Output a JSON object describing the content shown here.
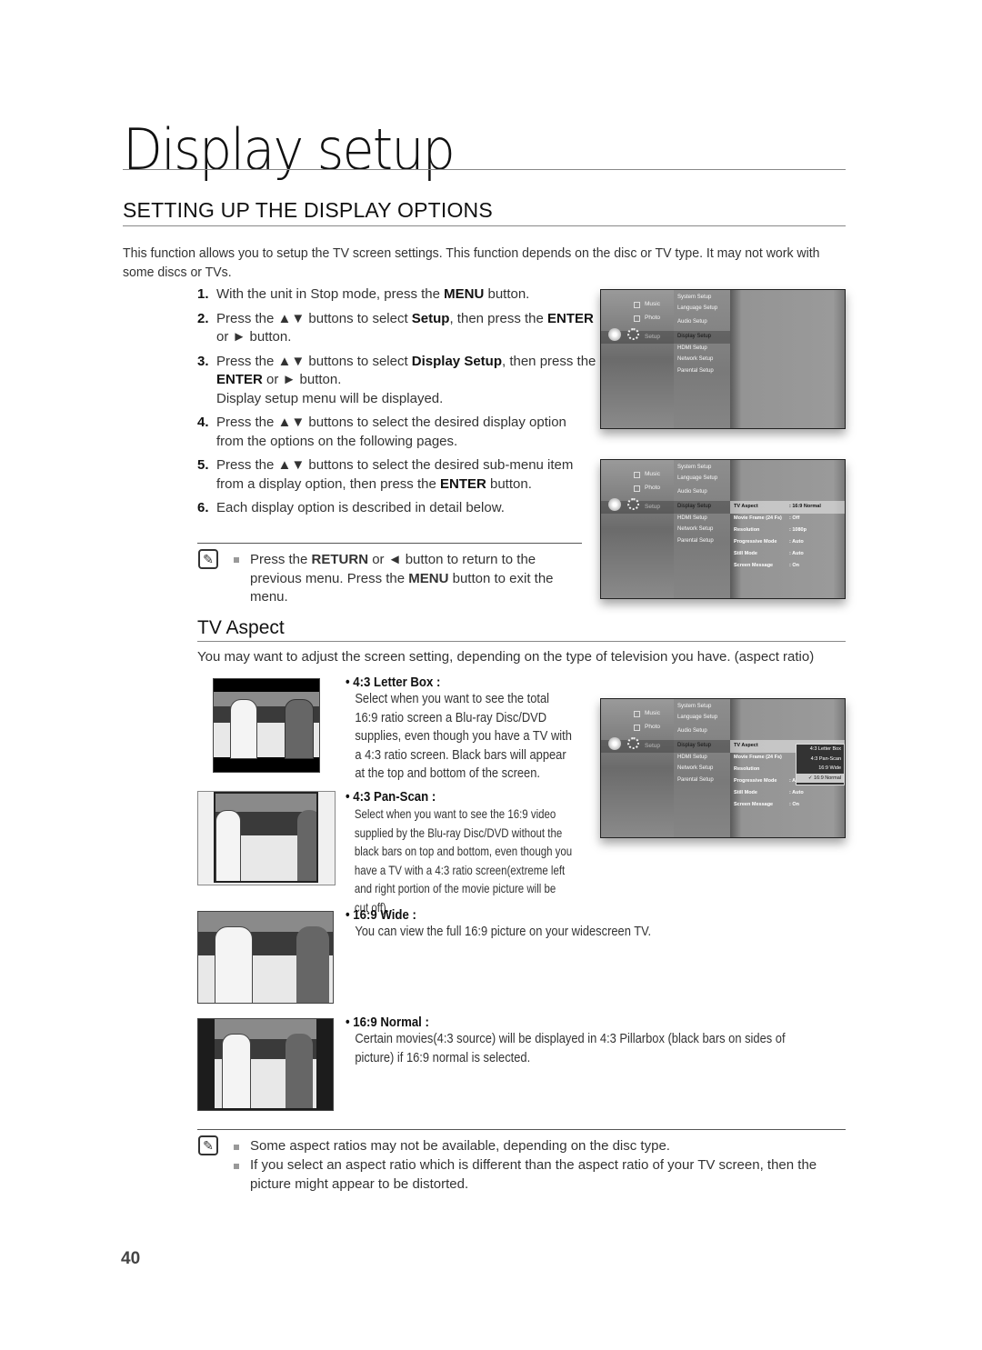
{
  "page": {
    "title": "Display setup",
    "number": "40"
  },
  "section": {
    "title": "SETTING UP THE DISPLAY OPTIONS",
    "intro": "This function allows you to setup the TV screen settings. This function depends on the disc or TV type. It may not work with some discs or TVs."
  },
  "steps": [
    {
      "num": "1.",
      "parts": [
        {
          "t": "With the unit in Stop mode, press the "
        },
        {
          "t": "MENU",
          "b": true
        },
        {
          "t": " button."
        }
      ]
    },
    {
      "num": "2.",
      "parts": [
        {
          "t": "Press the ▲▼ buttons to select "
        },
        {
          "t": "Setup",
          "b": true
        },
        {
          "t": ", then press the "
        },
        {
          "t": "ENTER",
          "b": true
        },
        {
          "t": " or ► button."
        }
      ]
    },
    {
      "num": "3.",
      "parts": [
        {
          "t": "Press the ▲▼ buttons to select "
        },
        {
          "t": "Display Setup",
          "b": true
        },
        {
          "t": ", then press the "
        },
        {
          "t": "ENTER",
          "b": true
        },
        {
          "t": " or ► button."
        },
        {
          "t": "Display setup menu will be displayed.",
          "br": true
        }
      ]
    },
    {
      "num": "4.",
      "parts": [
        {
          "t": "Press the ▲▼ buttons to select the desired display option from the options on the following pages."
        }
      ]
    },
    {
      "num": "5.",
      "parts": [
        {
          "t": "Press the ▲▼ buttons to select the desired sub-menu item from a display option, then press the "
        },
        {
          "t": "ENTER",
          "b": true
        },
        {
          "t": " button."
        }
      ]
    },
    {
      "num": "6.",
      "parts": [
        {
          "t": "Each display option is described in detail below."
        }
      ]
    }
  ],
  "note1": {
    "icon": "note-pencil-icon",
    "parts": [
      {
        "t": "Press the "
      },
      {
        "t": "RETURN",
        "b": true
      },
      {
        "t": " or ◄ button to return to the previous menu. Press the "
      },
      {
        "t": "MENU",
        "b": true
      },
      {
        "t": " button to exit the menu."
      }
    ]
  },
  "menu": {
    "main_items": [
      "Music",
      "Photo",
      "Setup"
    ],
    "setup_items": [
      "System Setup",
      "Language Setup",
      "Audio Setup",
      "Display Setup",
      "HDMI Setup",
      "Network Setup",
      "Parental Setup"
    ],
    "display_options": [
      {
        "label": "TV Aspect",
        "value": ": 16:9 Normal"
      },
      {
        "label": "Movie Frame (24 Fs)",
        "value": ": Off"
      },
      {
        "label": "Resolution",
        "value": ": 1080p"
      },
      {
        "label": "Progressive Mode",
        "value": ": Auto"
      },
      {
        "label": "Still Mode",
        "value": ": Auto"
      },
      {
        "label": "Screen Message",
        "value": ": On"
      }
    ],
    "aspect_popup": [
      "4:3 Letter Box",
      "4:3 Pan-Scan",
      "16:9 Wide",
      "✓ 16:9 Normal"
    ],
    "aspect_selected": "16:9 Normal"
  },
  "tv_aspect": {
    "title": "TV Aspect",
    "intro": "You may want to adjust the screen setting, depending on the type of television you have. (aspect ratio)",
    "options": [
      {
        "head": "• 4:3 Letter Box :",
        "body": "Select when you want to see the total 16:9 ratio screen a Blu-ray Disc/DVD supplies, even though you have a TV with a 4:3 ratio screen. Black bars will appear at the top and bottom of the screen."
      },
      {
        "head": "• 4:3 Pan-Scan :",
        "body": "Select when you want to see the 16:9 video supplied by the Blu-ray Disc/DVD without the black bars on top and bottom, even though you have a TV with a 4:3 ratio screen(extreme left and right portion of the movie picture will be cut off)."
      },
      {
        "head": "• 16:9 Wide :",
        "body": "You can view the full 16:9 picture on your widescreen TV."
      },
      {
        "head": "• 16:9 Normal :",
        "body": "Certain movies(4:3 source) will be displayed in 4:3 Pillarbox (black bars on sides of picture) if 16:9 normal is selected."
      }
    ]
  },
  "note2": {
    "icon": "note-pencil-icon",
    "items": [
      "Some aspect ratios may not be available, depending on the disc type.",
      "If you select an aspect ratio which is different than the aspect ratio of your TV screen, then the picture might appear to be distorted."
    ]
  }
}
